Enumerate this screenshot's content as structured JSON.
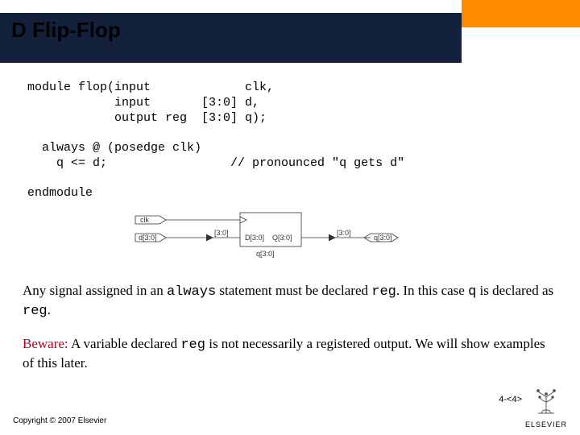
{
  "title": "D Flip-Flop",
  "code": "module flop(input             clk,\n            input       [3:0] d,\n            output reg  [3:0] q);\n\n  always @ (posedge clk)\n    q <= d;                 // pronounced \"q gets d\"\n\nendmodule",
  "diagram": {
    "inputs": {
      "clk": "clk",
      "d": "d[3:0]"
    },
    "block": {
      "clk_pin": ">",
      "d_pin": "D[3:0]",
      "q_pin": "Q[3:0]"
    },
    "outputs": {
      "q": "q[3:0]"
    },
    "bus_label_in": "[3:0]",
    "bus_label_out": "[3:0]",
    "net_label": "q[3:0]"
  },
  "para1": {
    "pre": "Any signal assigned in an ",
    "w1": "always",
    "mid1": " statement must be declared ",
    "w2": "reg",
    "mid2": ".  In this case ",
    "w3": "q",
    "mid3": " is declared as ",
    "w4": "reg",
    "end": "."
  },
  "para2": {
    "beware": "Beware:",
    "pre": "  A variable declared ",
    "w1": "reg",
    "mid": " is not necessarily a registered output. We will show examples of this later."
  },
  "copyright": "Copyright © 2007 Elsevier",
  "slide_num": "4-<4>",
  "logo_text": "ELSEVIER"
}
